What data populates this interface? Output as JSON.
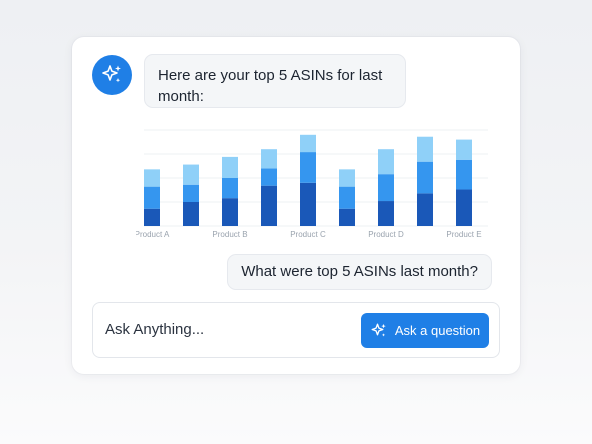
{
  "assistant_message": "Here are your top 5 ASINs for last month:",
  "user_message": "What were top 5 ASINs last month?",
  "input": {
    "placeholder": "Ask Anything..."
  },
  "ask_button": {
    "label": "Ask a question",
    "icon": "sparkle-icon"
  },
  "avatar": {
    "icon": "sparkle-icon"
  },
  "colors": {
    "accent": "#1f7fe6",
    "series_dark": "#1a58b8",
    "series_mid": "#3596ef",
    "series_light": "#8fd0f8"
  },
  "chart_data": {
    "type": "bar",
    "stacked": true,
    "tick_labels": [
      "Product A",
      "",
      "Product B",
      "",
      "Product C",
      "",
      "Product D",
      "",
      "Product E"
    ],
    "ylim": [
      0,
      10
    ],
    "grid": true,
    "series": [
      {
        "values": [
          1.8,
          2.5,
          2.9,
          4.2,
          4.5,
          1.8,
          2.6,
          3.4,
          3.8
        ]
      },
      {
        "values": [
          2.3,
          1.8,
          2.1,
          1.8,
          3.2,
          2.3,
          2.8,
          3.3,
          3.1
        ]
      },
      {
        "values": [
          1.8,
          2.1,
          2.2,
          2.0,
          1.8,
          1.8,
          2.6,
          2.6,
          2.1
        ]
      }
    ]
  }
}
